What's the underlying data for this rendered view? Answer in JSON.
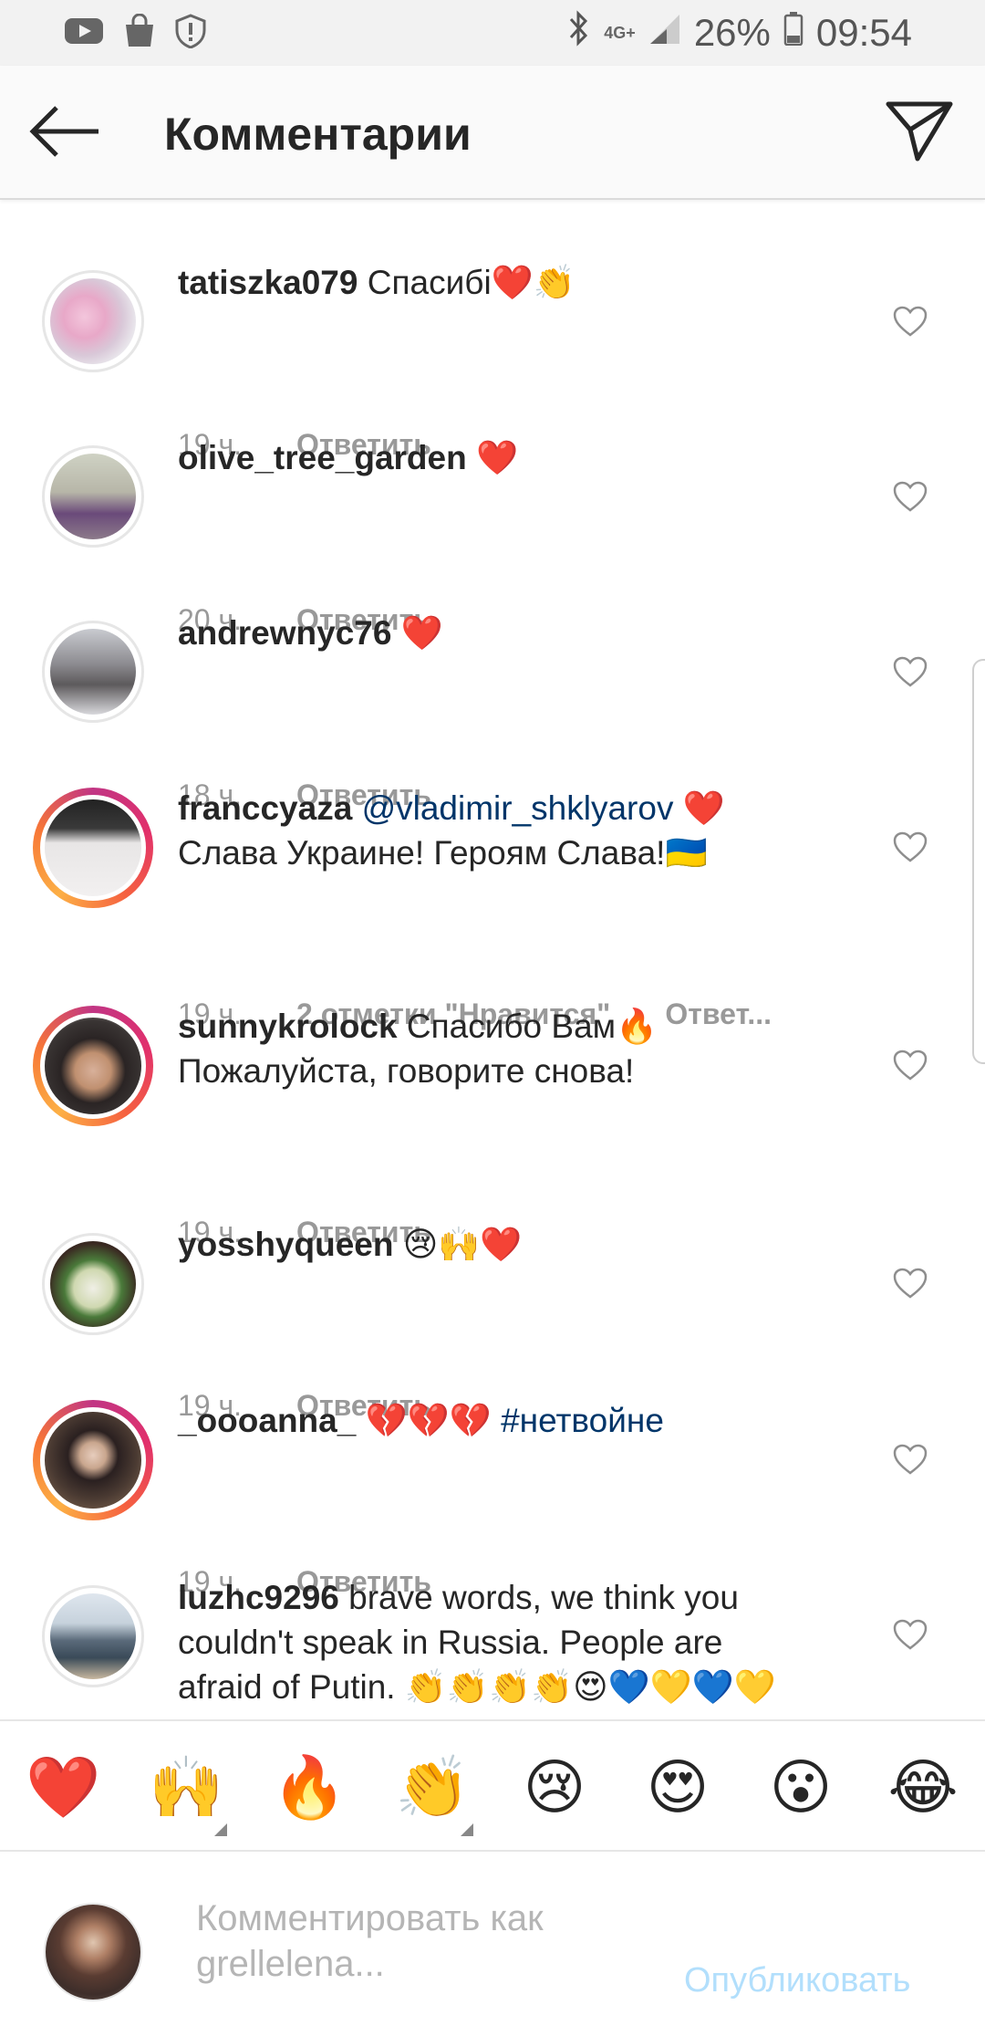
{
  "status_bar": {
    "network": "4G+",
    "battery": "26%",
    "time": "09:54"
  },
  "header": {
    "title": "Комментарии"
  },
  "comments": [
    {
      "username": "tatiszka079",
      "text": "Спасибі❤️👏",
      "time": "19 ч.",
      "reply": "Ответить"
    },
    {
      "username": "olive_tree_garden",
      "text": "❤️",
      "time": "20 ч.",
      "reply": "Ответить"
    },
    {
      "username": "andrewnyc76",
      "text": "❤️",
      "time": "18 ч.",
      "reply": "Ответить"
    },
    {
      "username": "franccyaza",
      "mention": "@vladimir_shklyarov",
      "text": "❤️",
      "text2": "Слава Украине! Героям Слава!🇺🇦",
      "time": "19 ч.",
      "likes": "2 отметки \"Нравится\"",
      "reply": "Ответ..."
    },
    {
      "username": "sunnykrolock",
      "text": "Спасибо Вам🔥",
      "text2": "Пожалуйста, говорите снова!",
      "time": "19 ч.",
      "reply": "Ответить"
    },
    {
      "username": "yosshyqueen",
      "text": "😢🙌❤️",
      "time": "19 ч.",
      "reply": "Ответить"
    },
    {
      "username": "_oooanna_",
      "text": "💔💔💔",
      "hashtag": "#нетвойне",
      "time": "19 ч.",
      "reply": "Ответить"
    },
    {
      "username": "luzhc9296",
      "text": "brave words, we think you",
      "text2": "couldn't speak in Russia. People are",
      "text3": "afraid of Putin. 👏👏👏👏😍💙💛💙💛"
    }
  ],
  "emoji_bar": [
    "❤️",
    "🙌",
    "🔥",
    "👏",
    "😢",
    "😍",
    "😮",
    "😂"
  ],
  "compose": {
    "placeholder_line1": "Комментировать как",
    "placeholder_line2": "grellelena...",
    "publish": "Опубликовать"
  },
  "colors": {
    "mention": "#003569",
    "meta": "#999999",
    "publish_disabled": "#b2dffc",
    "story_ring": [
      "#c13584",
      "#f56040",
      "#fcaf45"
    ]
  }
}
